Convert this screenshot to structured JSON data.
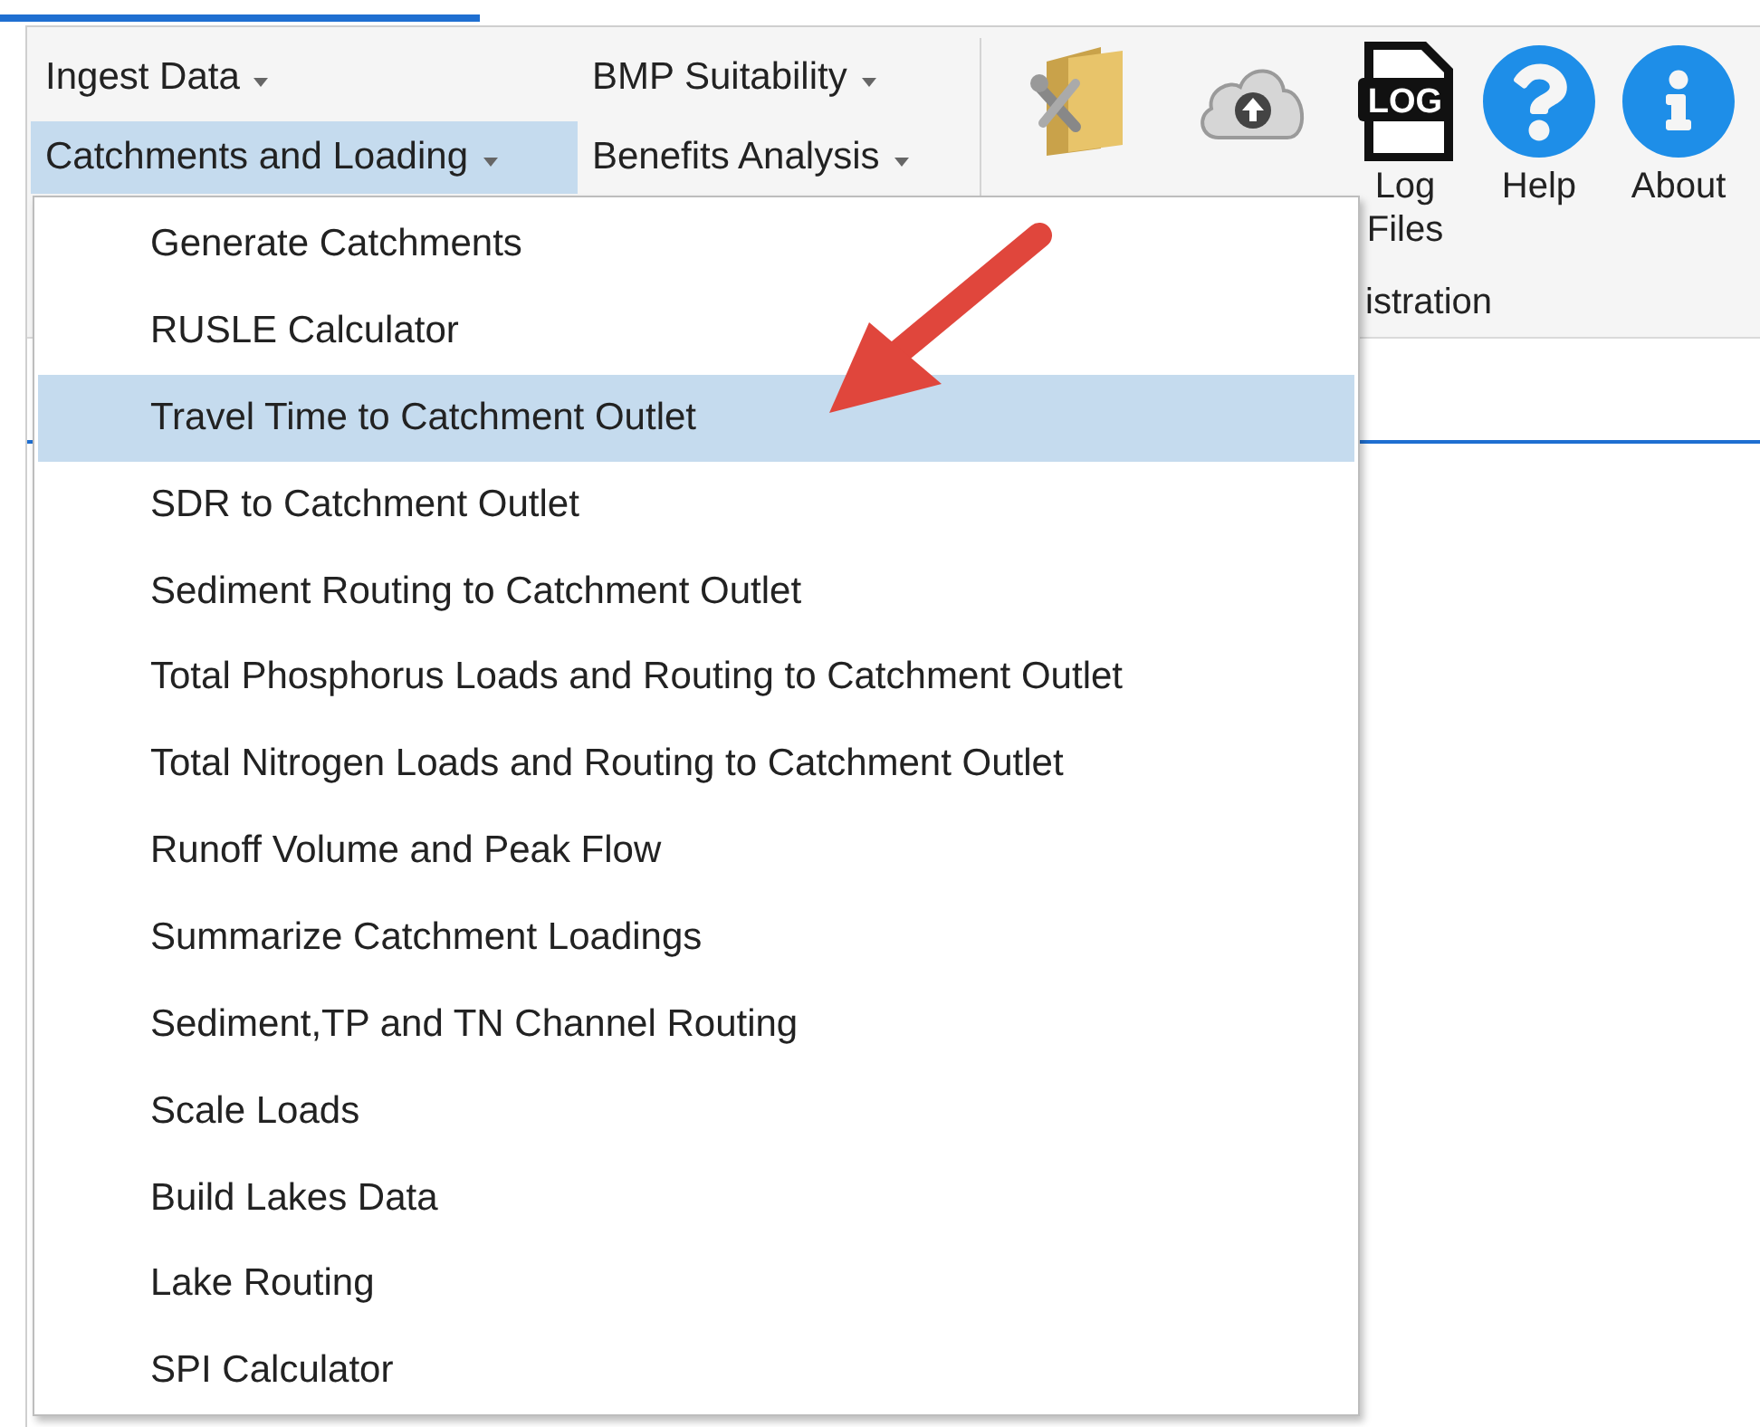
{
  "ribbon": {
    "menus": [
      {
        "label": "Ingest Data",
        "selected": false
      },
      {
        "label": "BMP Suitability",
        "selected": false
      },
      {
        "label": "Catchments and Loading",
        "selected": true
      },
      {
        "label": "Benefits Analysis",
        "selected": false
      }
    ],
    "tools": [
      {
        "kind": "settings"
      },
      {
        "kind": "extract"
      },
      {
        "kind": "log",
        "label": "Log Files",
        "icon_text": "LOG"
      },
      {
        "kind": "help",
        "label": "Help"
      },
      {
        "kind": "about",
        "label": "About"
      }
    ],
    "group_label": "istration"
  },
  "menu": {
    "items": [
      {
        "label": "Generate Catchments",
        "selected": false
      },
      {
        "label": "RUSLE Calculator",
        "selected": false
      },
      {
        "label": "Travel Time to Catchment Outlet",
        "selected": true
      },
      {
        "label": "SDR to Catchment Outlet",
        "selected": false
      },
      {
        "label": "Sediment Routing to Catchment Outlet",
        "selected": false
      },
      {
        "label": "Total Phosphorus Loads and Routing to Catchment Outlet",
        "selected": false
      },
      {
        "label": "Total Nitrogen Loads and Routing to Catchment Outlet",
        "selected": false
      },
      {
        "label": "Runoff Volume and Peak Flow",
        "selected": false
      },
      {
        "label": "Summarize Catchment Loadings",
        "selected": false
      },
      {
        "label": "Sediment,TP and TN Channel Routing",
        "selected": false
      },
      {
        "label": "Scale Loads",
        "selected": false
      },
      {
        "label": "Build Lakes Data",
        "selected": false
      },
      {
        "label": "Lake Routing",
        "selected": false
      },
      {
        "label": "SPI Calculator",
        "selected": false
      }
    ]
  }
}
